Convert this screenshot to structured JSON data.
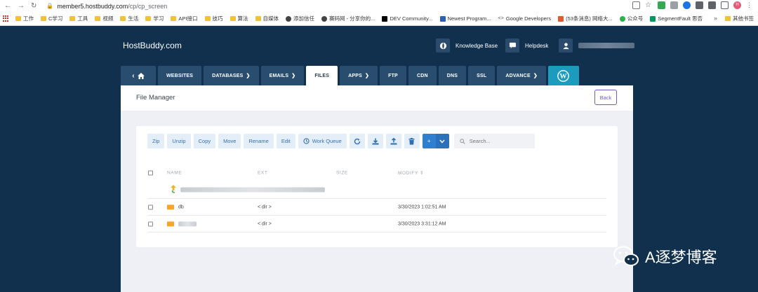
{
  "browser": {
    "url_host": "member5.hostbuddy.com",
    "url_path": "/cp/cp_screen",
    "profile_initial": "H",
    "bookmarks": [
      {
        "label": "工作",
        "icon": "folder-icon"
      },
      {
        "label": "C学习",
        "icon": "folder-icon"
      },
      {
        "label": "工具",
        "icon": "folder-icon"
      },
      {
        "label": "视频",
        "icon": "folder-icon"
      },
      {
        "label": "生活",
        "icon": "folder-icon"
      },
      {
        "label": "学习",
        "icon": "folder-icon"
      },
      {
        "label": "API接口",
        "icon": "folder-icon"
      },
      {
        "label": "技巧",
        "icon": "folder-icon"
      },
      {
        "label": "算法",
        "icon": "folder-icon"
      },
      {
        "label": "自媒体",
        "icon": "folder-icon"
      },
      {
        "label": "添加信任",
        "icon": "globe-icon"
      },
      {
        "label": "赛码网 - 分享你的...",
        "icon": "globe-icon"
      },
      {
        "label": "DEV Community...",
        "icon": "dev-icon"
      },
      {
        "label": "Newest Program...",
        "icon": "stack-icon"
      },
      {
        "label": "Google Developers",
        "icon": "code-icon"
      },
      {
        "label": "(53条消息) 网络大...",
        "icon": "csdn-icon"
      },
      {
        "label": "公众号",
        "icon": "wechat-icon"
      },
      {
        "label": "SegmentFault 思否",
        "icon": "sf-icon"
      }
    ],
    "more": "»",
    "other_bookmarks": "其他书签"
  },
  "header": {
    "brand": "HostBuddy.com",
    "knowledge_base": "Knowledge Base",
    "helpdesk": "Helpdesk"
  },
  "tabs": [
    {
      "label": "WEBSITES",
      "dropdown": false
    },
    {
      "label": "DATABASES",
      "dropdown": true
    },
    {
      "label": "EMAILS",
      "dropdown": true
    },
    {
      "label": "FILES",
      "dropdown": false,
      "active": true
    },
    {
      "label": "APPS",
      "dropdown": true
    },
    {
      "label": "FTP",
      "dropdown": false
    },
    {
      "label": "CDN",
      "dropdown": false
    },
    {
      "label": "DNS",
      "dropdown": false
    },
    {
      "label": "SSL",
      "dropdown": false
    },
    {
      "label": "ADVANCE",
      "dropdown": true
    }
  ],
  "panel": {
    "title": "File Manager",
    "back": "Back"
  },
  "toolbar": {
    "zip": "Zip",
    "unzip": "Unzip",
    "copy": "Copy",
    "move": "Move",
    "rename": "Rename",
    "edit": "Edit",
    "work_queue": "Work Queue",
    "plus": "+",
    "search_placeholder": "Search..."
  },
  "table": {
    "columns": [
      "NAME",
      "EXT",
      "SIZE",
      "MODIFY"
    ],
    "rows": [
      {
        "name": "db",
        "ext": "< dir >",
        "modify": "3/30/2023 1:02:51 AM"
      },
      {
        "name": "",
        "ext": "< dir >",
        "modify": "3/30/2023 3:31:12 AM"
      }
    ]
  },
  "watermark": "A逐梦博客",
  "colors": {
    "page_bg": "#11304e",
    "tab_bg": "#284d6e",
    "wordpress_tab": "#1d9bbf",
    "button_bg": "#e3eef9",
    "button_text": "#3a6ea8",
    "primary": "#2f7fd1",
    "back_button": "#6b5fc7",
    "folder": "#f5a623"
  }
}
